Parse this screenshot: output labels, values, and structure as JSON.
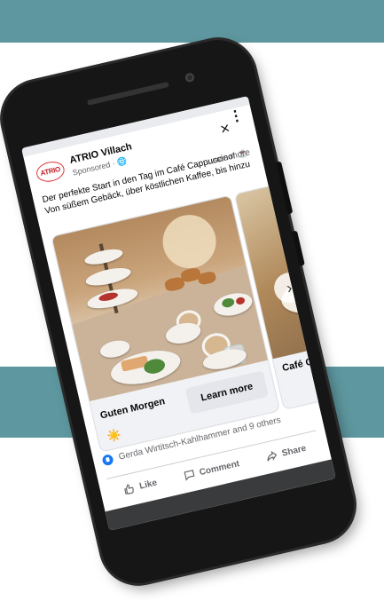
{
  "ad": {
    "page_name": "ATRIO Villach",
    "logo_text": "ATRIO",
    "sponsored": "Sponsored · ",
    "globe_icon": "globe-icon",
    "text": "Der perfekte Start in den Tag im Café Cappuccino! ☕ Von süßem Gebäck, über köstlichen Kaffee, bis hinzu",
    "see_more": "...see more"
  },
  "cards": [
    {
      "title": "Guten Morgen",
      "emoji": "☀️",
      "cta": "Learn more"
    },
    {
      "title": "Café Cappuc"
    }
  ],
  "reactions": {
    "text": "Gerda Wirtitsch-Kahlhammer and 9 others"
  },
  "actions": {
    "like": "Like",
    "comment": "Comment",
    "share": "Share"
  },
  "icons": {
    "close": "×",
    "more": "⋮",
    "next": "›"
  },
  "colors": {
    "band": "#5e979f",
    "facebook_blue": "#1877f2",
    "phone": "#161616"
  }
}
